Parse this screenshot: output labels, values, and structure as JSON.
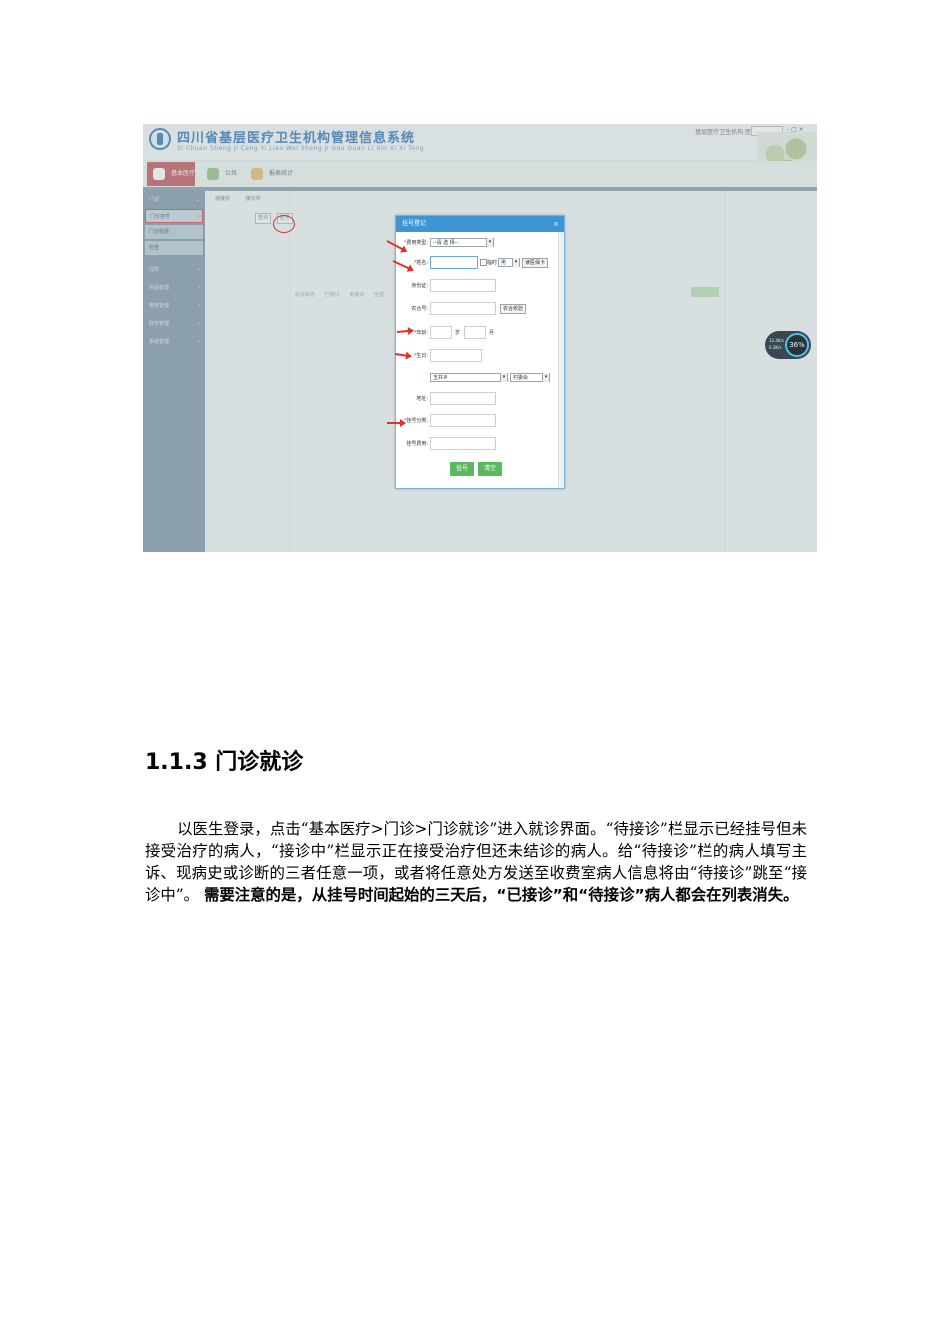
{
  "screenshot": {
    "system_title": "四川省基层医疗卫生机构管理信息系统",
    "system_subtitle": "Si Chuan Sheng Ji Ceng Yi Liao Wei Sheng Ji Gou Guan Li Xin Xi Xi Tong",
    "user_info": "基层医疗卫生机构 医生",
    "window_controls": "- □ ×",
    "main_tabs": [
      {
        "label": "基本医疗",
        "icon": "medical-cross-icon",
        "color": "#c14e52"
      },
      {
        "label": "公共卫生",
        "icon": "home-icon",
        "color": "#6aa35a"
      },
      {
        "label": "报表统计",
        "icon": "report-icon",
        "color": "#e1a23a"
      }
    ],
    "sidebar": {
      "items": [
        {
          "label": "门诊",
          "kind": "header"
        },
        {
          "label": "门诊挂号",
          "kind": "sub-selected"
        },
        {
          "label": "门诊收费",
          "kind": "sub"
        },
        {
          "label": "检查",
          "kind": "sub"
        },
        {
          "label": "住院",
          "kind": "group"
        },
        {
          "label": "药品管理",
          "kind": "group"
        },
        {
          "label": "物资管理",
          "kind": "group"
        },
        {
          "label": "财务管理",
          "kind": "group"
        },
        {
          "label": "系统管理",
          "kind": "group"
        }
      ]
    },
    "content": {
      "tabs": [
        "待接诊",
        "接诊中"
      ],
      "query_label": "查询",
      "reg_button": "挂号",
      "status_items": [
        "就诊状态",
        "已接诊",
        "未接诊",
        "全部"
      ]
    },
    "speed_widget": {
      "percent": "36%",
      "net_up": "12.4K/s",
      "net_down": "0.3K/s"
    },
    "dialog": {
      "title": "挂号登记",
      "close": "×",
      "fields": {
        "fee_type": {
          "label": "费用类型:",
          "required": true,
          "value": "--请 选 择--"
        },
        "name": {
          "label": "姓名:",
          "required": true,
          "value": ""
        },
        "temp_label": "临时",
        "gender": "男",
        "read_card": "读医保卡",
        "id_card": {
          "label": "身份证:",
          "value": ""
        },
        "nhc_no": {
          "label": "农合号:",
          "value": ""
        },
        "nhc_check": "农合校验",
        "age": {
          "label": "年龄:",
          "required": true,
          "unit_year": "岁",
          "unit_month": "月"
        },
        "birthday": {
          "label": "生日:",
          "required": true
        },
        "township": "玉井乡",
        "village": "村委会",
        "address": {
          "label": "地址:"
        },
        "reg_category": {
          "label": "挂号分类:",
          "required": true
        },
        "reg_fee": {
          "label": "挂号费用:"
        }
      },
      "buttons": {
        "register": "挂号",
        "cancel": "清空"
      }
    }
  },
  "document": {
    "heading": "1.1.3 门诊就诊",
    "paragraph_normal": "以医生登录，点击“基本医疗>门诊>门诊就诊”进入就诊界面。“待接诊”栏显示已经挂号但未接受治疗的病人，“接诊中”栏显示正在接受治疗但还未结诊的病人。给“待接诊”栏的病人填写主诉、现病史或诊断的三者任意一项，或者将任意处方发送至收费室病人信息将由“待接诊”跳至“接诊中”。",
    "paragraph_bold": "需要注意的是，从挂号时间起始的三天后，“已接诊”和“待接诊”病人都会在列表消失。"
  }
}
